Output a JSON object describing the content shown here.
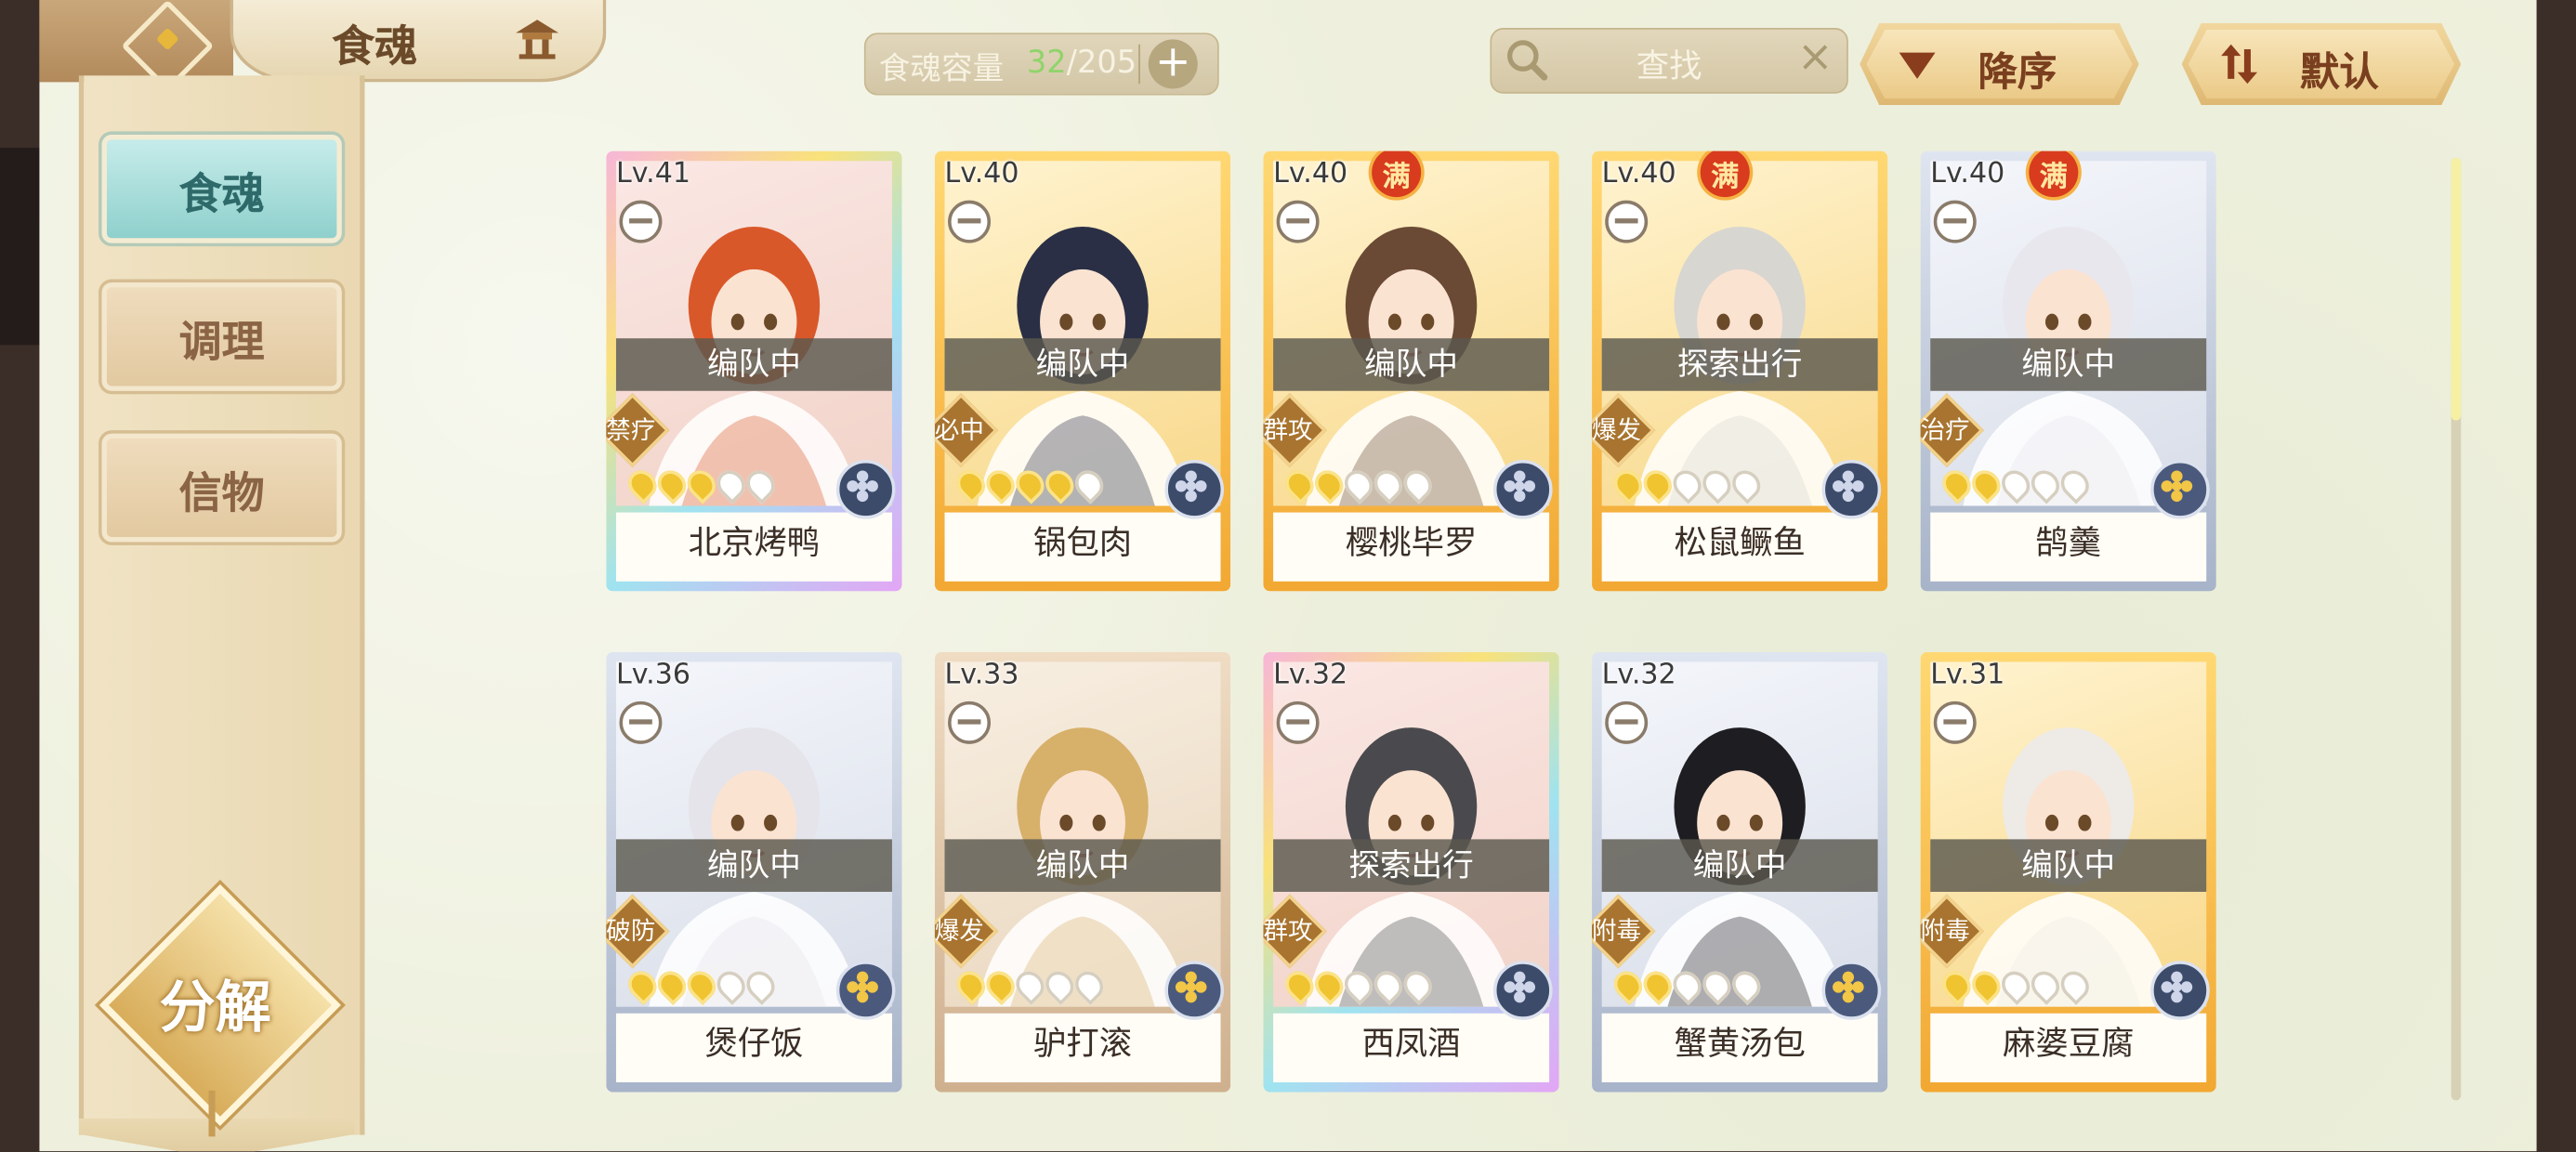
{
  "header": {
    "title": "食魂",
    "capacity_label": "食魂容量",
    "capacity_used": "32",
    "capacity_separator": "/",
    "capacity_total": "205",
    "search_placeholder": "查找",
    "sort_order_label": "降序",
    "sort_mode_label": "默认"
  },
  "sidebar": {
    "items": [
      {
        "label": "食魂",
        "active": true
      },
      {
        "label": "调理",
        "active": false
      },
      {
        "label": "信物",
        "active": false
      }
    ],
    "decompose_label": "分解"
  },
  "max_badge_label": "满",
  "cards": [
    {
      "level": "Lv.41",
      "status": "编队中",
      "role": "禁疗",
      "stars": 3,
      "name": "北京烤鸭",
      "rarity": "rainbow",
      "max": false,
      "element": "blue",
      "hair": "#d9582a"
    },
    {
      "level": "Lv.40",
      "status": "编队中",
      "role": "必中",
      "stars": 4,
      "name": "锅包肉",
      "rarity": "gold",
      "max": false,
      "element": "blue",
      "hair": "#2a2f45"
    },
    {
      "level": "Lv.40",
      "status": "编队中",
      "role": "群攻",
      "stars": 2,
      "name": "樱桃毕罗",
      "rarity": "gold",
      "max": true,
      "element": "blue",
      "hair": "#6b4a35"
    },
    {
      "level": "Lv.40",
      "status": "探索出行",
      "role": "爆发",
      "stars": 2,
      "name": "松鼠鳜鱼",
      "rarity": "gold",
      "max": true,
      "element": "blue",
      "hair": "#d8d6d0"
    },
    {
      "level": "Lv.40",
      "status": "编队中",
      "role": "治疗",
      "stars": 2,
      "name": "鹄羹",
      "rarity": "silver",
      "max": true,
      "element": "gold",
      "hair": "#e9e7ee"
    },
    {
      "level": "Lv.36",
      "status": "编队中",
      "role": "破防",
      "stars": 3,
      "name": "煲仔饭",
      "rarity": "silver",
      "max": false,
      "element": "gold",
      "hair": "#e4e4ea"
    },
    {
      "level": "Lv.33",
      "status": "编队中",
      "role": "爆发",
      "stars": 2,
      "name": "驴打滚",
      "rarity": "bronze",
      "max": false,
      "element": "gold",
      "hair": "#d7b06a"
    },
    {
      "level": "Lv.32",
      "status": "探索出行",
      "role": "群攻",
      "stars": 2,
      "name": "西凤酒",
      "rarity": "rainbow",
      "max": false,
      "element": "blue",
      "hair": "#4a4a4e"
    },
    {
      "level": "Lv.32",
      "status": "编队中",
      "role": "附毒",
      "stars": 2,
      "name": "蟹黄汤包",
      "rarity": "silver",
      "max": false,
      "element": "gold",
      "hair": "#1e1e22"
    },
    {
      "level": "Lv.31",
      "status": "编队中",
      "role": "附毒",
      "stars": 2,
      "name": "麻婆豆腐",
      "rarity": "gold",
      "max": false,
      "element": "blue",
      "hair": "#eeeae6"
    }
  ],
  "colors": {
    "rainbow": "#e7a3e8",
    "gold": "#f4c24a",
    "silver": "#b9c3d6",
    "bronze": "#d9c2a6",
    "status_overlay": "#5a584e",
    "role_badge": "#a8742f"
  }
}
